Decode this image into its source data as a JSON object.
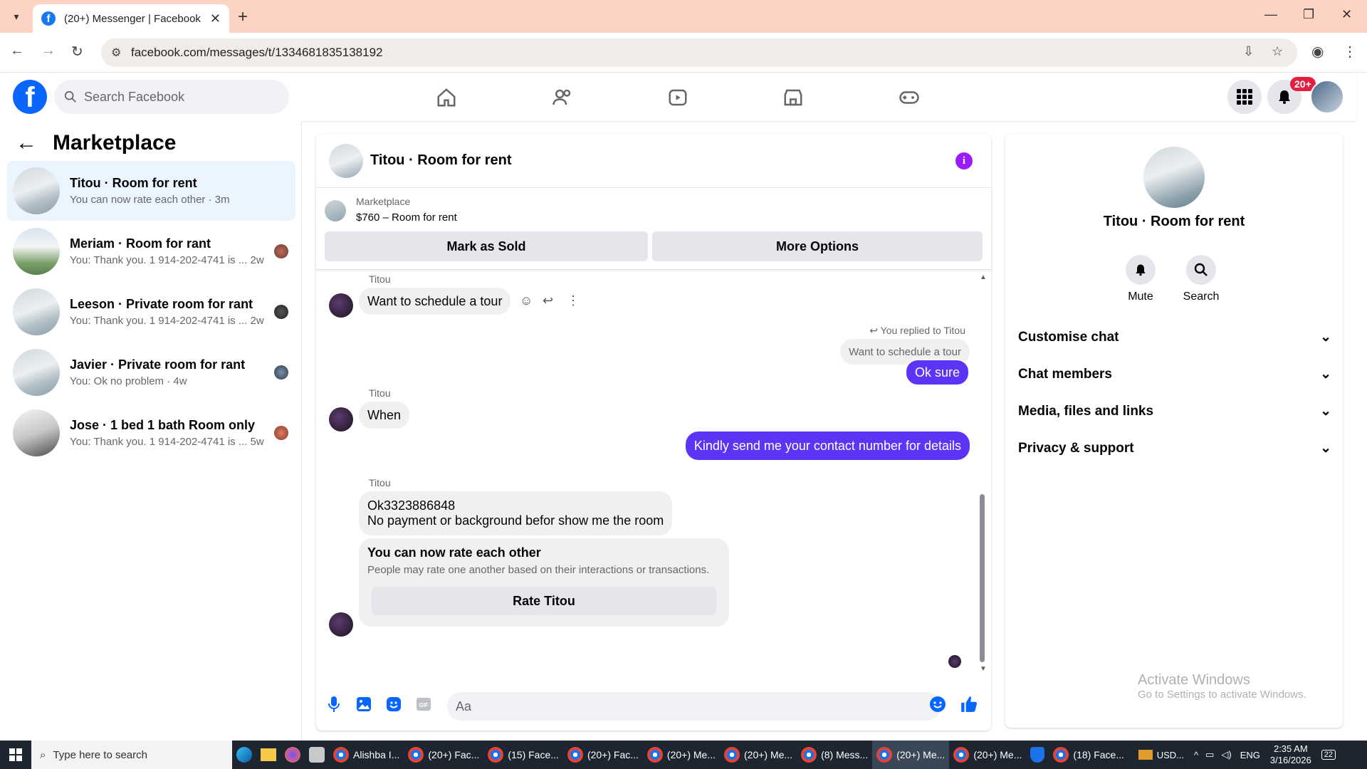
{
  "browser": {
    "tab_title": "(20+) Messenger | Facebook",
    "url": "facebook.com/messages/t/1334681835138192"
  },
  "header": {
    "search_placeholder": "Search Facebook",
    "notif_badge": "20+"
  },
  "left_panel": {
    "title": "Marketplace",
    "conversations": [
      {
        "name": "Titou · Room for rent",
        "snippet": "You can now rate each other · 3m",
        "time": ""
      },
      {
        "name": "Meriam · Room for rant",
        "snippet": "You: Thank you. 1 914-202-4741 is ...",
        "time": "2w"
      },
      {
        "name": "Leeson · Private room for rant",
        "snippet": "You: Thank you. 1 914-202-4741 is ...",
        "time": "2w"
      },
      {
        "name": "Javier · Private room for rant",
        "snippet": "You: Ok no problem · 4w",
        "time": ""
      },
      {
        "name": "Jose · 1 bed 1 bath Room only",
        "snippet": "You: Thank you. 1 914-202-4741 is ...",
        "time": "5w"
      }
    ]
  },
  "chat": {
    "title": "Titou · Room for rent",
    "listing_label": "Marketplace",
    "listing_price": "$760 – Room for rent",
    "mark_sold": "Mark as Sold",
    "more_options": "More Options",
    "sender_name": "Titou",
    "msg1": "Want to schedule a tour",
    "replied_label": "You replied to Titou",
    "quoted": "Want to schedule a tour",
    "msg2": "Ok sure",
    "msg3": "When",
    "msg4": "Kindly send me your contact number for details",
    "msg5_line1": "Ok3323886848",
    "msg5_line2": "No payment or background befor  show me the room",
    "rate_title": "You can now rate each other",
    "rate_desc": "People may rate one another based on their interactions or transactions.",
    "rate_button": "Rate Titou",
    "input_placeholder": "Aa"
  },
  "right_panel": {
    "name": "Titou · Room for rent",
    "mute": "Mute",
    "search": "Search",
    "sections": [
      "Customise chat",
      "Chat members",
      "Media, files and links",
      "Privacy & support"
    ]
  },
  "watermark": {
    "line1": "Activate Windows",
    "line2": "Go to Settings to activate Windows."
  },
  "taskbar": {
    "search": "Type here to search",
    "items": [
      "Alishba I...",
      "(20+) Fac...",
      "(15) Face...",
      "(20+) Fac...",
      "(20+) Me...",
      "(20+) Me...",
      "(8) Mess...",
      "(20+) Me...",
      "(20+) Me...",
      "(18) Face..."
    ],
    "currency": "USD...",
    "lang": "ENG",
    "time": "2:35 AM",
    "date": "3/16/2026",
    "notif_count": "22"
  }
}
